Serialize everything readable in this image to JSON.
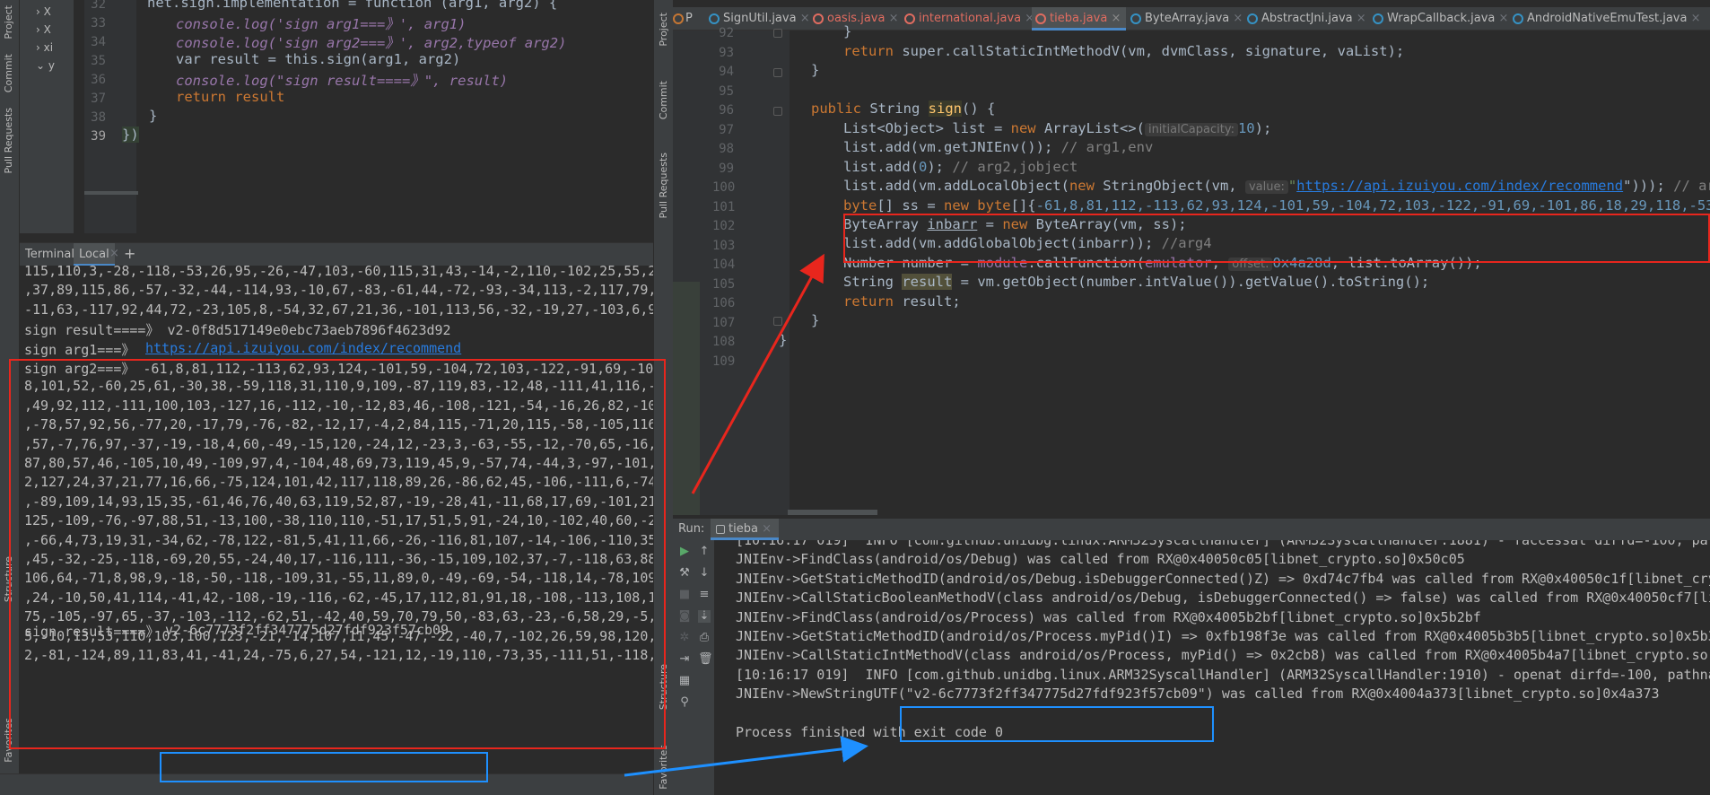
{
  "left_strip": {
    "project": "Project",
    "commit": "Commit",
    "pull_requests": "Pull Requests",
    "structure": "Structure",
    "favorites": "Favorites"
  },
  "tree": {
    "items": [
      "X",
      "X",
      "xi",
      "y"
    ]
  },
  "left_editor": {
    "lines": [
      {
        "n": "32",
        "code": "net.sign.implementation = function (arg1, arg2) {"
      },
      {
        "n": "33",
        "code": "console.log('sign arg1===》', arg1)"
      },
      {
        "n": "34",
        "code": "console.log('sign arg2===》', arg2,typeof arg2)"
      },
      {
        "n": "35",
        "code": "var result = this.sign(arg1, arg2)"
      },
      {
        "n": "36",
        "code": "console.log(\"sign result====》\", result)"
      },
      {
        "n": "37",
        "code": "return result"
      },
      {
        "n": "38",
        "code": "}"
      },
      {
        "n": "39",
        "code": "})"
      }
    ]
  },
  "terminal": {
    "tab_label": "Terminal:",
    "local_tab": "Local",
    "add": "+",
    "lines": [
      "115,110,3,-28,-118,-53,26,95,-26,-47,103,-60,115,31,43,-14,-2,110,-102,25,55,2",
      ",37,89,115,86,-57,-32,-44,-114,93,-10,67,-83,-61,44,-72,-93,-34,113,-2,117,79,",
      "-11,63,-117,92,44,72,-23,105,8,-54,32,67,21,36,-101,113,56,-32,-19,27,-103,6,9",
      "sign result====》 v2-0f8d517149e0ebc73aeb7896f4623d92",
      "sign arg1===》 ",
      "sign arg2===》 -61,8,81,112,-113,62,93,124,-101,59,-104,72,103,-122,-91,69,-10",
      "8,101,52,-60,25,61,-30,38,-59,118,31,110,9,109,-87,119,83,-12,48,-111,41,116,-",
      ",49,92,112,-111,100,103,-127,16,-112,-10,-12,83,46,-108,-121,-54,-16,26,82,-10",
      ",-78,57,92,56,-77,20,-17,79,-76,-82,-12,17,-4,2,84,115,-71,20,115,-58,-105,116",
      ",57,-7,76,97,-37,-19,-18,4,60,-49,-15,120,-24,12,-23,3,-63,-55,-12,-70,65,-16,",
      "87,80,57,46,-105,10,49,-109,97,4,-104,48,69,73,119,45,9,-57,74,-44,3,-97,-101,",
      "2,127,24,37,21,77,16,66,-75,124,101,42,117,118,89,26,-86,62,45,-106,-111,6,-74",
      ",-89,109,14,93,15,35,-61,46,76,40,63,119,52,87,-19,-28,41,-11,68,17,69,-101,21",
      "125,-109,-76,-97,88,51,-13,100,-38,110,110,-51,17,51,5,91,-24,10,-102,40,60,-2",
      ",-66,4,73,19,31,-34,62,-78,122,-81,5,41,11,66,-26,-116,81,107,-14,-106,-110,35",
      ",45,-32,-25,-118,-69,20,55,-24,40,17,-116,111,-36,-15,109,102,37,-7,-118,63,88",
      "106,64,-71,8,98,9,-18,-50,-118,-109,31,-55,11,89,0,-49,-69,-54,-118,14,-78,109",
      ",24,-10,50,41,114,-41,42,-108,-19,-116,-62,-45,17,112,81,91,18,-108,-113,108,1",
      "75,-105,-97,65,-37,-103,-112,-62,51,-42,40,59,70,79,50,-83,63,-23,-6,58,29,-5,",
      "5,-10,13,53,110,103,100,123,-21,-14,107,11,45,-47,-22,-40,7,-102,26,59,98,120,",
      "2,-81,-124,89,11,83,41,-41,24,-75,6,27,54,-121,12,-19,110,-73,35,-111,51,-118,",
      "sign result====》 "
    ],
    "arg1_url": "https://api.izuiyou.com/index/recommend",
    "final_result": "v2-6c7773f2ff347775d27fdf923f57cb09"
  },
  "tabs": [
    {
      "label": "P",
      "state": "normal"
    },
    {
      "label": "SignUtil.java",
      "state": "normal"
    },
    {
      "label": "oasis.java",
      "state": "err"
    },
    {
      "label": "international.java",
      "state": "err"
    },
    {
      "label": "tieba.java",
      "state": "active"
    },
    {
      "label": "ByteArray.java",
      "state": "normal"
    },
    {
      "label": "AbstractJni.java",
      "state": "normal"
    },
    {
      "label": "WrapCallback.java",
      "state": "normal"
    },
    {
      "label": "AndroidNativeEmuTest.java",
      "state": "normal"
    }
  ],
  "right_editor": {
    "line_numbers": [
      "92",
      "93",
      "94",
      "95",
      "96",
      "97",
      "98",
      "99",
      "100",
      "101",
      "102",
      "103",
      "104",
      "105",
      "106",
      "107",
      "108",
      "109"
    ],
    "l92": "}",
    "l93_kw": "return ",
    "l93_rest": "super.callStaticIntMethodV(vm, dvmClass, signature, vaList);",
    "l94": "}",
    "l96_kw": "public ",
    "l96_type": "String ",
    "l96_fn": "sign",
    "l96_rest": "() {",
    "l97_a": "List<Object> list = ",
    "l97_kw": "new ",
    "l97_b": "ArrayList<>(",
    "l97_hint": "initialCapacity:",
    "l97_num": "10",
    "l97_c": ");",
    "l98_a": "list.add(vm.getJNIEnv()); ",
    "l98_cm": "// arg1,env",
    "l99_a": "list.add(",
    "l99_num": "0",
    "l99_b": "); ",
    "l99_cm": "// arg2,jobject",
    "l100_a": "list.add(vm.addLocalObject(",
    "l100_kw": "new ",
    "l100_b": "StringObject(vm, ",
    "l100_hint": "value:",
    "l100_q": "\"",
    "l100_url": "https://api.izuiyou.com/index/recommend",
    "l100_c": "\"))); ",
    "l100_cm": "// arg",
    "l101_kw1": "byte",
    "l101_a": "[] ss = ",
    "l101_kw2": "new byte",
    "l101_b": "[]{",
    "l101_nums": "-61,8,81,112,-113,62,93,124,-101,59,-104,72,103,-122,-91,69,-101,86,18,29,118,-53,-",
    "l102_a": "ByteArray ",
    "l102_u": "inbarr",
    "l102_b": " = ",
    "l102_kw": "new ",
    "l102_c": "ByteArray(vm, ss);",
    "l103_a": "list.add(vm.addGlobalObject(inbarr)); ",
    "l103_cm": "//arg4",
    "l104_a": "Number number = ",
    "l104_mod": "module",
    "l104_b": ".callFunction(",
    "l104_emu": "emulator",
    "l104_c": ", ",
    "l104_hint": "offset:",
    "l104_num": "0x4a28d",
    "l104_d": ", list.toArray());",
    "l105_a": "String ",
    "l105_res": "result",
    "l105_b": " = vm.getObject(number.intValue()).getValue().toString();",
    "l106_kw": "return ",
    "l106_b": "result;",
    "l107": "}",
    "l108": "}"
  },
  "run": {
    "label": "Run:",
    "tab": "tieba",
    "lines": [
      "[10:16:17 019]  INFO [com.github.unidbg.linux.ARM32SyscallHandler] (ARM32SyscallHandler:1881) - faccessat dirfd=-100, pat",
      "JNIEnv->FindClass(android/os/Debug) was called from RX@0x40050c05[libnet_crypto.so]0x50c05",
      "JNIEnv->GetStaticMethodID(android/os/Debug.isDebuggerConnected()Z) => 0xd74c7fb4 was called from RX@0x40050c1f[libnet_cry",
      "JNIEnv->CallStaticBooleanMethodV(class android/os/Debug, isDebuggerConnected() => false) was called from RX@0x40050cf7[li",
      "JNIEnv->FindClass(android/os/Process) was called from RX@0x4005b2bf[libnet_crypto.so]0x5b2bf",
      "JNIEnv->GetStaticMethodID(android/os/Process.myPid()I) => 0xfb198f3e was called from RX@0x4005b3b5[libnet_crypto.so]0x5b3",
      "JNIEnv->CallStaticIntMethodV(class android/os/Process, myPid() => 0x2cb8) was called from RX@0x4005b4a7[libnet_crypto.so]",
      "[10:16:17 019]  INFO [com.github.unidbg.linux.ARM32SyscallHandler] (ARM32SyscallHandler:1910) - openat dirfd=-100, pathna",
      "JNIEnv->NewStringUTF(\"v2-6c7773f2ff347775d27fdf923f57cb09\") was called from RX@0x4004a373[libnet_crypto.so]0x4a373",
      "",
      "Process finished with exit code 0"
    ]
  },
  "colors": {
    "red_box": "#e8261d",
    "blue_box": "#1e90ff",
    "accent": "#4a88c7"
  }
}
